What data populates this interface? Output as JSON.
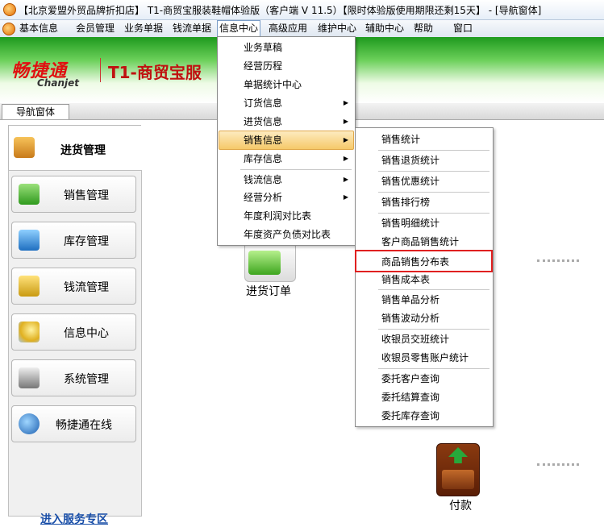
{
  "window": {
    "title": "【北京爱盟外贸品牌折扣店】 T1-商贸宝服装鞋帽体验版（客户端 V 11.5）【限时体验版使用期限还剩15天】 - [导航窗体]"
  },
  "menubar": [
    "基本信息",
    "会员管理",
    "业务单据",
    "钱流单据",
    "信息中心",
    "高级应用",
    "维护中心",
    "辅助中心",
    "帮助",
    "窗口"
  ],
  "banner": {
    "brand_cn": "畅捷通",
    "brand_en": "Chanjet",
    "product": "T1-商贸宝服"
  },
  "tab": {
    "label": "导航窗体"
  },
  "sidebar": {
    "active": "进货管理",
    "items": [
      "销售管理",
      "库存管理",
      "钱流管理",
      "信息中心",
      "系统管理",
      "畅捷通在线"
    ],
    "service_link": "进入服务专区"
  },
  "flow": {
    "purchase_order": "进货订单",
    "payment": "付款"
  },
  "info_menu": {
    "items": [
      {
        "label": "业务草稿",
        "sub": false
      },
      {
        "label": "经营历程",
        "sub": false
      },
      {
        "label": "单据统计中心",
        "sub": false
      },
      {
        "label": "订货信息",
        "sub": true
      },
      {
        "label": "进货信息",
        "sub": true
      },
      {
        "label": "销售信息",
        "sub": true
      },
      {
        "label": "库存信息",
        "sub": true
      },
      {
        "label": "钱流信息",
        "sub": true
      },
      {
        "label": "经营分析",
        "sub": true
      },
      {
        "label": "年度利润对比表",
        "sub": false
      },
      {
        "label": "年度资产负债对比表",
        "sub": false
      }
    ],
    "highlighted": "销售信息"
  },
  "sales_menu": {
    "items": [
      "销售统计",
      "销售退货统计",
      "销售优惠统计",
      "销售排行榜",
      "销售明细统计",
      "客户商品销售统计",
      "商品销售分布表",
      "销售成本表",
      "销售单品分析",
      "销售波动分析",
      "收银员交班统计",
      "收银员零售账户统计",
      "委托客户查询",
      "委托结算查询",
      "委托库存查询"
    ],
    "boxed": "商品销售分布表"
  },
  "colors": {
    "highlight": "#f6c969",
    "redbox": "#e02020",
    "link": "#1a4fa8"
  }
}
